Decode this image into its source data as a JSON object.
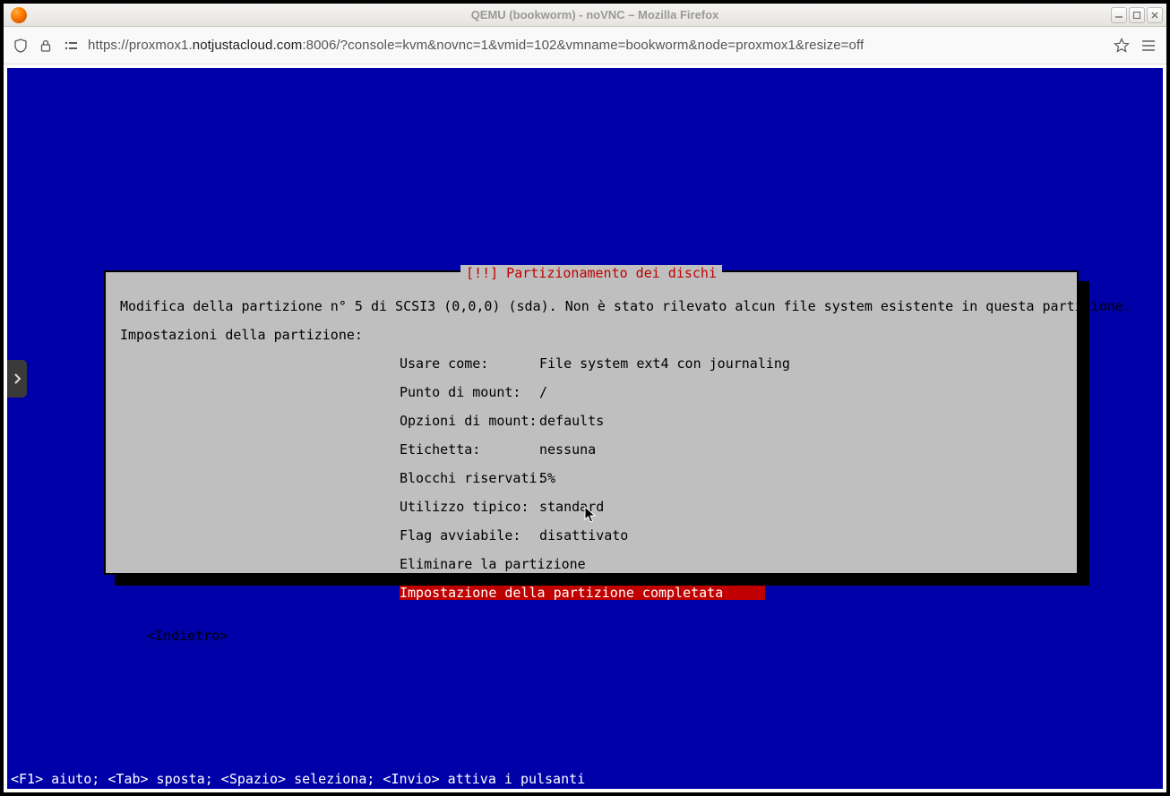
{
  "window": {
    "title": "QEMU (bookworm) - noVNC – Mozilla Firefox"
  },
  "url": {
    "prefix": "https://proxmox1.",
    "host": "notjustacloud.com",
    "suffix": ":8006/?console=kvm&novnc=1&vmid=102&vmname=bookworm&node=proxmox1&resize=off"
  },
  "dialog": {
    "title": "[!!] Partizionamento dei dischi",
    "intro": "Modifica della partizione n° 5 di SCSI3 (0,0,0) (sda). Non è stato rilevato alcun file system esistente in questa partizione.",
    "settings_label": "Impostazioni della partizione:",
    "rows": [
      {
        "label": "Usare come:",
        "value": "File system ext4 con journaling"
      },
      {
        "label": "Punto di mount:",
        "value": "/"
      },
      {
        "label": "Opzioni di mount:",
        "value": "defaults"
      },
      {
        "label": "Etichetta:",
        "value": "nessuna"
      },
      {
        "label": "Blocchi riservati:",
        "value": "5%"
      },
      {
        "label": "Utilizzo tipico:",
        "value": "standard"
      },
      {
        "label": "Flag avviabile:",
        "value": "disattivato"
      }
    ],
    "actions": {
      "delete": "Eliminare la partizione",
      "done": "Impostazione della partizione completata"
    },
    "back": "<Indietro>"
  },
  "footer": "<F1> aiuto; <Tab> sposta; <Spazio> seleziona; <Invio> attiva i pulsanti",
  "icons": {
    "toggle_prefs": "⚙"
  }
}
